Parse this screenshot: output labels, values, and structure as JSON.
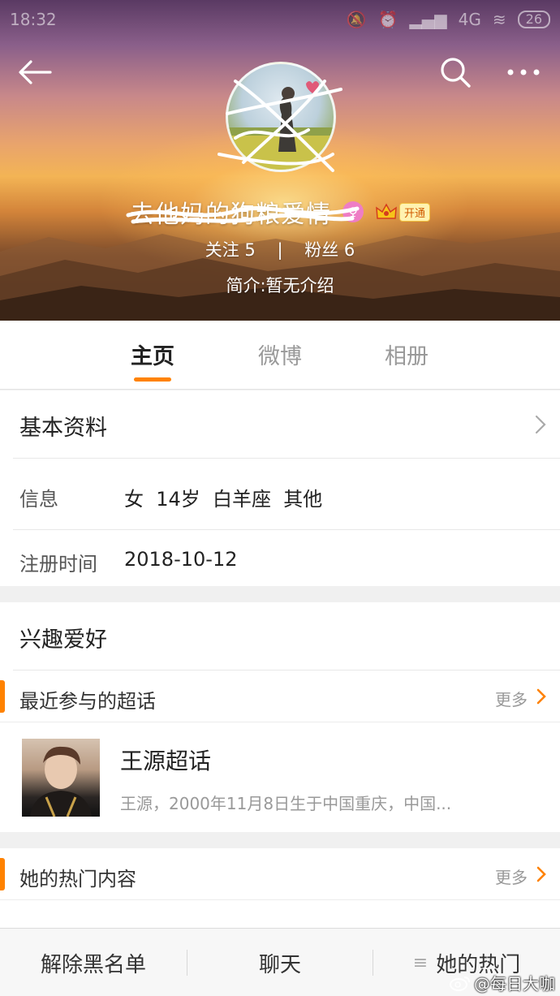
{
  "statusbar": {
    "time": "18:32",
    "network": "4G",
    "battery": "26"
  },
  "header": {
    "back_icon": "back-arrow-icon",
    "search_icon": "search-icon",
    "more_icon": "more-dots-icon",
    "username": "去他妈的狗粮爱情",
    "vip_label": "开通",
    "following_label": "关注",
    "following_count": "5",
    "separator": "|",
    "followers_label": "粉丝",
    "followers_count": "6",
    "bio": "简介:暂无介绍"
  },
  "tabs": [
    {
      "label": "主页",
      "active": true
    },
    {
      "label": "微博",
      "active": false
    },
    {
      "label": "相册",
      "active": false
    }
  ],
  "basic_info": {
    "title": "基本资料",
    "info_label": "信息",
    "info_value": "女  14岁  白羊座  其他",
    "register_label": "注册时间",
    "register_value": "2018-10-12"
  },
  "interests": {
    "title": "兴趣爱好",
    "super_topics_title": "最近参与的超话",
    "more_label": "更多",
    "topic_name": "王源超话",
    "topic_desc": "王源，2000年11月8日生于中国重庆，中国..."
  },
  "hot_content": {
    "title": "她的热门内容",
    "more_label": "更多"
  },
  "bottom_bar": {
    "unblock": "解除黑名单",
    "chat": "聊天",
    "hot_menu_icon": "≡",
    "hot": "她的热门"
  },
  "watermark": "@每日大咖",
  "colors": {
    "accent": "#ff8200",
    "female_badge": "#ee7dc5"
  }
}
